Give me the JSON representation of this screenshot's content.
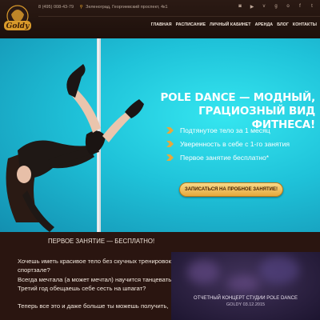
{
  "header": {
    "logo_text": "Goldy",
    "phone": "8 (495) 008-43-79",
    "address": "Зеленоград, Георгиевский проспект, 4к1",
    "socials": [
      "instagram-icon",
      "youtube-icon",
      "vk-icon",
      "google-plus-icon",
      "odnoklassniki-icon",
      "facebook-icon",
      "twitter-icon"
    ],
    "nav": [
      "ГЛАВНАЯ",
      "РАСПИСАНИЕ",
      "ЛИЧНЫЙ КАБИНЕТ",
      "АРЕНДА",
      "БЛОГ",
      "КОНТАКТЫ"
    ]
  },
  "hero": {
    "title_line1": "POLE DANCE — МОДНЫЙ,",
    "title_line2": "ГРАЦИОЗНЫЙ ВИД ФИТНЕСА!",
    "benefits": [
      "Подтянутое тело за 1 месяц",
      "Уверенность в себе с 1-го занятия",
      "Первое занятие бесплатно*"
    ],
    "cta_label": "ЗАПИСАТЬСЯ НА ПРОБНОЕ ЗАНЯТИЕ!"
  },
  "free_section": {
    "title": "ПЕРВОЕ ЗАНЯТИЕ — БЕСПЛАТНО!",
    "lines": [
      "Хочешь иметь красивое тело без скучных тренировок в",
      "спортзале?",
      "Всегда мечтала (а может мечтал) научится танцевать?",
      "Третий год обещаешь себе сесть на шпагат?",
      "",
      "Теперь все это и даже больше ты можешь получить,"
    ]
  },
  "video": {
    "title": "ОТЧЕТНЫЙ КОНЦЕРТ СТУДИИ POLE DANCE",
    "subtitle": "GOLDY 03.12.2015"
  },
  "colors": {
    "accent": "#e7a83c",
    "hero_bg": "#1fc2d9",
    "dark_bg": "#2a1510"
  }
}
